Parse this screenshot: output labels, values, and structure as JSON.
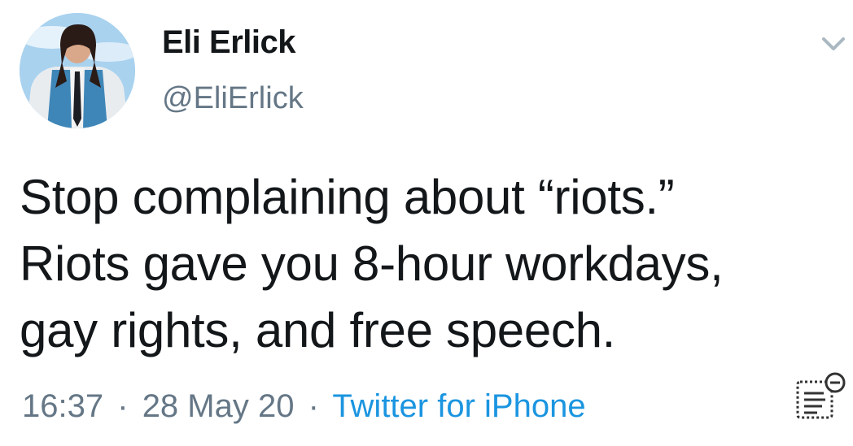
{
  "user": {
    "display_name": "Eli Erlick",
    "handle": "@EliErlick"
  },
  "tweet": {
    "lines": [
      "Stop complaining about “riots.”",
      "Riots gave you 8-hour workdays,",
      "gay rights, and free speech."
    ],
    "time": "16:37",
    "date": "28 May 20",
    "separator": "·",
    "source": "Twitter for iPhone"
  },
  "icons": {
    "menu": "chevron-down-icon",
    "avatar": "avatar",
    "overlay": "reader-mode-icon"
  },
  "colors": {
    "text": "#14171a",
    "secondary": "#657786",
    "link": "#1b95e0"
  }
}
